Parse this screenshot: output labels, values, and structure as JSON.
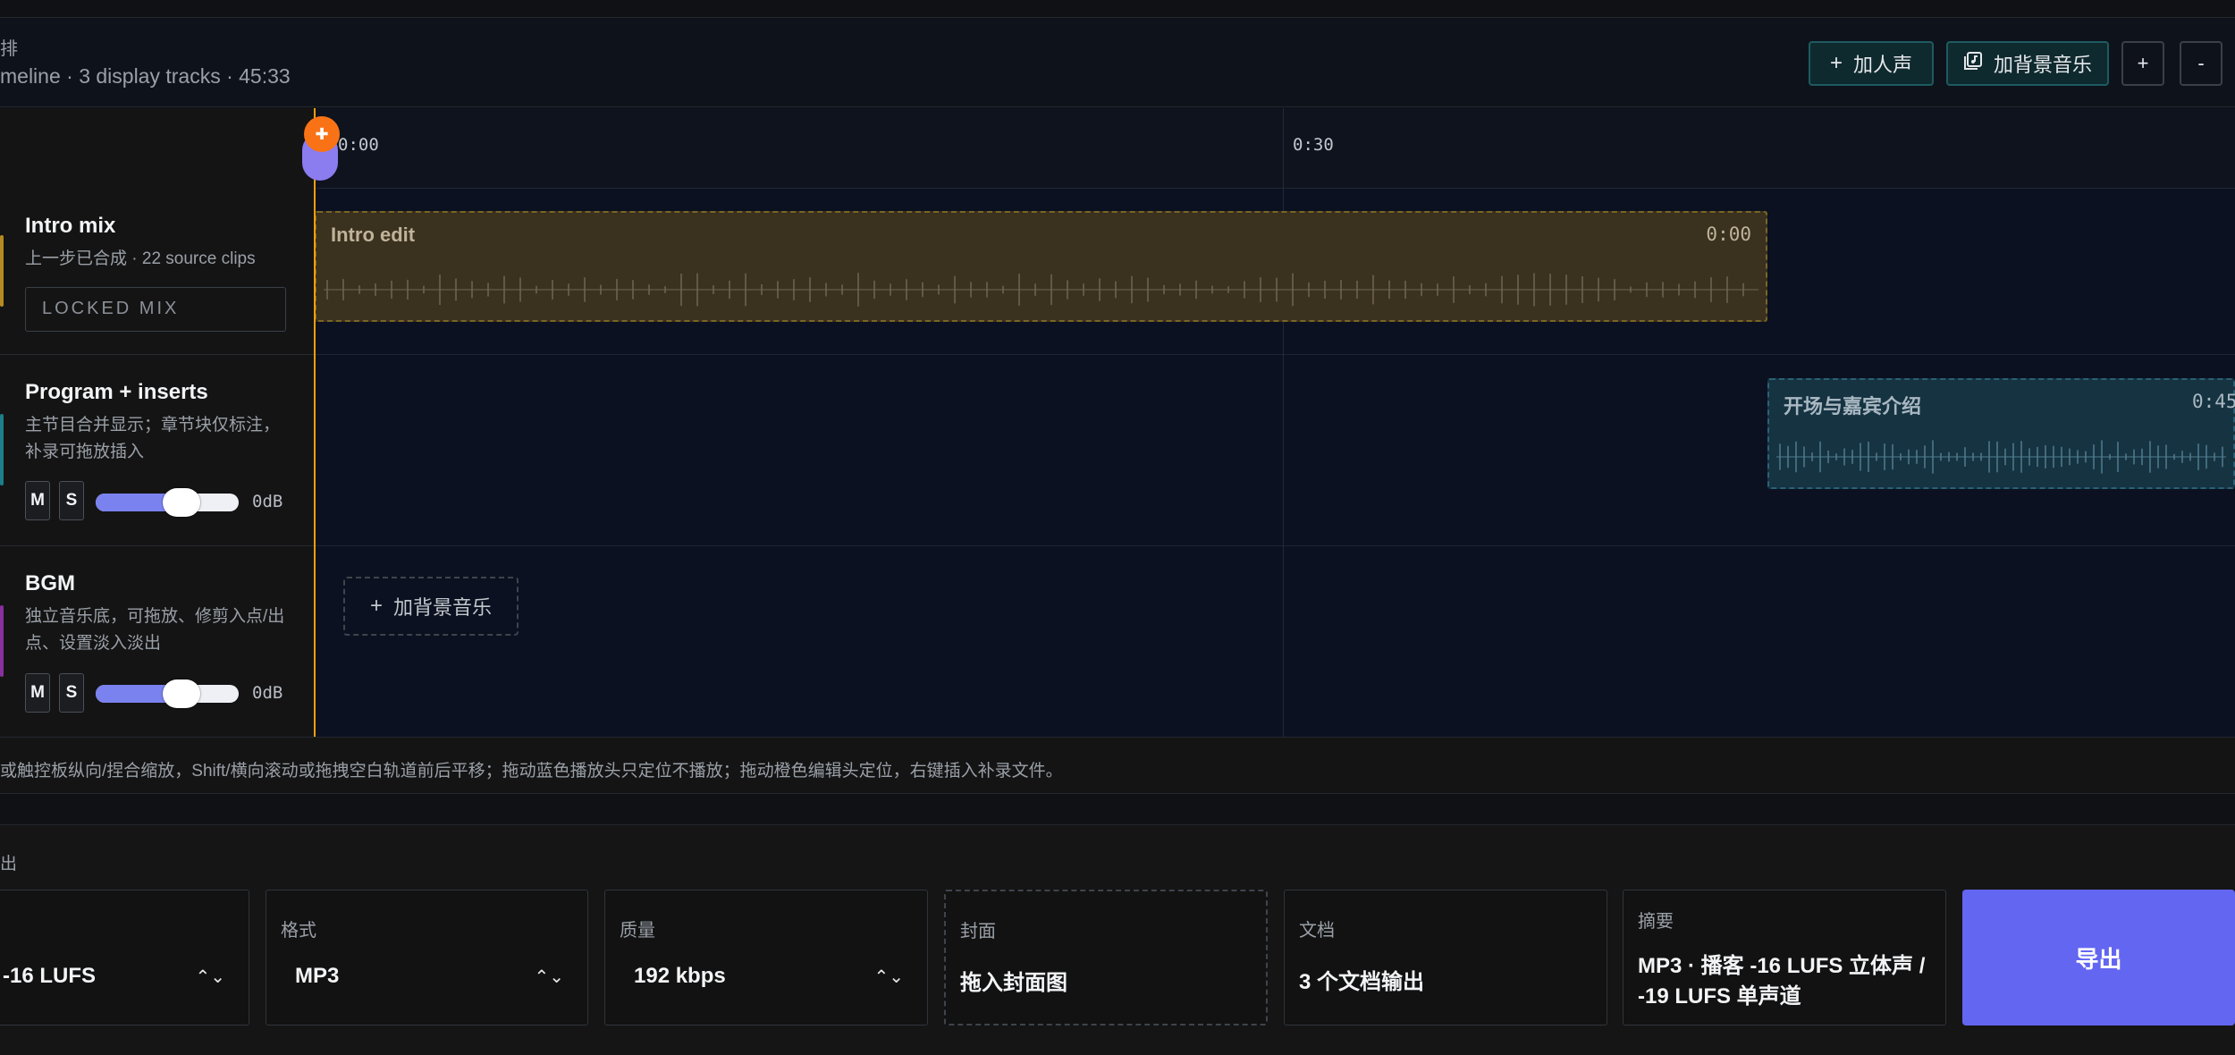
{
  "header": {
    "title": "排",
    "subtitle": "meline · 3 display tracks · 45:33",
    "add_voice": "加人声",
    "add_bgm": "加背景音乐",
    "zoom_in": "+",
    "zoom_out": "-"
  },
  "ruler": {
    "start": "0:00",
    "mark_30": "0:30"
  },
  "tracks": [
    {
      "name": "Intro mix",
      "desc": "上一步已合成 · 22 source clips",
      "badge": "LOCKED MIX",
      "color": "#b58a1f"
    },
    {
      "name": "Program + inserts",
      "desc": "主节目合并显示；章节块仅标注，补录可拖放插入",
      "mute": "M",
      "solo": "S",
      "gain": "0dB",
      "volume_fraction": 0.6,
      "color": "#1c7f89"
    },
    {
      "name": "BGM",
      "desc": "独立音乐底，可拖放、修剪入点/出点、设置淡入淡出",
      "mute": "M",
      "solo": "S",
      "gain": "0dB",
      "volume_fraction": 0.6,
      "color": "#8a2f9e"
    }
  ],
  "clips": {
    "intro": {
      "title": "Intro edit",
      "time": "0:00"
    },
    "program": {
      "title": "开场与嘉宾介绍",
      "time": "0:45"
    }
  },
  "add_bgm_label": "加背景音乐",
  "hint": "或触控板纵向/捏合缩放，Shift/横向滚动或拖拽空白轨道前后平移；拖动蓝色播放头只定位不播放；拖动橙色编辑头定位，右键插入补录文件。",
  "export": {
    "section_label": "出",
    "loudness": {
      "value": "-16 LUFS"
    },
    "format": {
      "label": "格式",
      "value": "MP3"
    },
    "quality": {
      "label": "质量",
      "value": "192 kbps"
    },
    "cover": {
      "label": "封面",
      "value": "拖入封面图"
    },
    "docs": {
      "label": "文档",
      "value": "3 个文档输出"
    },
    "summary": {
      "label": "摘要",
      "line1": "MP3 · 播客 -16 LUFS 立体声 /",
      "line2": "-19 LUFS 单声道"
    },
    "export_button": "导出"
  },
  "colors": {
    "accent": "#6366f1",
    "playhead": "#f59e0b",
    "edithead": "#f97316"
  }
}
